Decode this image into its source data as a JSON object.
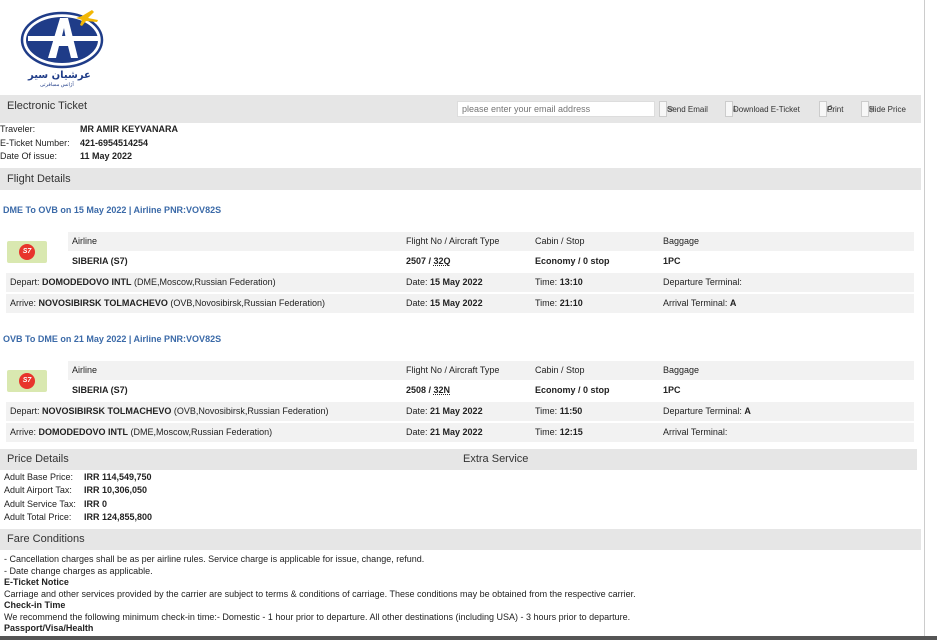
{
  "brand": {
    "name": "عرشيان سير",
    "tagline": "آژانس مسافرتی"
  },
  "header": {
    "title": "Electronic Ticket",
    "email_placeholder": "please enter your email address",
    "buttons": [
      "Send Email",
      "Download E-Ticket",
      "Print",
      "Hide Price"
    ]
  },
  "traveler": {
    "traveler_label": "Traveler:",
    "traveler": "MR AMIR KEYVANARA",
    "ticket_label": "E-Ticket Number:",
    "ticket": "421-6954514254",
    "date_label": "Date Of issue:",
    "date": "11 May 2022"
  },
  "flight_details_title": "Flight Details",
  "headers": {
    "airline": "Airline",
    "flight": "Flight No / Aircraft Type",
    "cabin": "Cabin / Stop",
    "baggage": "Baggage"
  },
  "labels": {
    "depart": "Depart:",
    "arrive": "Arrive:",
    "date": "Date:",
    "time": "Time:",
    "dep_terminal": "Departure Terminal:",
    "arr_terminal": "Arrival Terminal:"
  },
  "flights": [
    {
      "route": "DME To OVB on 15 May 2022 | Airline PNR:VOV82S",
      "airline": "SIBERIA (S7)",
      "flight_no": "2507 / ",
      "aircraft": "32Q",
      "cabin": "Economy / 0 stop",
      "baggage": "1PC",
      "depart_name": "DOMODEDOVO INTL",
      "depart_loc": " (DME,Moscow,Russian Federation)",
      "depart_date": "15 May 2022",
      "depart_time": "13:10",
      "depart_terminal": "",
      "arrive_name": "NOVOSIBIRSK TOLMACHEVO",
      "arrive_loc": " (OVB,Novosibirsk,Russian Federation)",
      "arrive_date": "15 May 2022",
      "arrive_time": "21:10",
      "arrive_terminal": "A"
    },
    {
      "route": "OVB To DME on 21 May 2022 | Airline PNR:VOV82S",
      "airline": "SIBERIA (S7)",
      "flight_no": "2508 / ",
      "aircraft": "32N",
      "cabin": "Economy / 0 stop",
      "baggage": "1PC",
      "depart_name": "NOVOSIBIRSK TOLMACHEVO",
      "depart_loc": " (OVB,Novosibirsk,Russian Federation)",
      "depart_date": "21 May 2022",
      "depart_time": "11:50",
      "depart_terminal": "A",
      "arrive_name": "DOMODEDOVO INTL",
      "arrive_loc": " (DME,Moscow,Russian Federation)",
      "arrive_date": "21 May 2022",
      "arrive_time": "12:15",
      "arrive_terminal": ""
    }
  ],
  "price": {
    "title": "Price Details",
    "extra_title": "Extra Service",
    "rows": [
      {
        "label": "Adult Base Price:",
        "value": "IRR 114,549,750"
      },
      {
        "label": "Adult Airport Tax:",
        "value": "IRR 10,306,050"
      },
      {
        "label": "Adult Service Tax:",
        "value": "IRR 0"
      },
      {
        "label": "Adult Total Price:",
        "value": "IRR 124,855,800"
      }
    ]
  },
  "fare": {
    "title": "Fare Conditions",
    "lines": [
      {
        "text": "- Cancellation charges shall be as per airline rules. Service charge is applicable for issue, change, refund.",
        "bold": false
      },
      {
        "text": "- Date change charges as applicable.",
        "bold": false
      },
      {
        "text": "E-Ticket Notice",
        "bold": true
      },
      {
        "text": "Carriage and other services provided by the carrier are subject to terms & conditions of carriage. These conditions may be obtained from the respective carrier.",
        "bold": false
      },
      {
        "text": "Check-in Time",
        "bold": true
      },
      {
        "text": "We recommend the following minimum check-in time:- Domestic - 1 hour prior to departure. All other destinations (including USA) - 3 hours prior to departure.",
        "bold": false
      },
      {
        "text": "Passport/Visa/Health",
        "bold": true
      }
    ]
  },
  "colors": {
    "accent": "#3b6aa8",
    "bar": "#e6e6e6",
    "row": "#f2f2f2"
  }
}
